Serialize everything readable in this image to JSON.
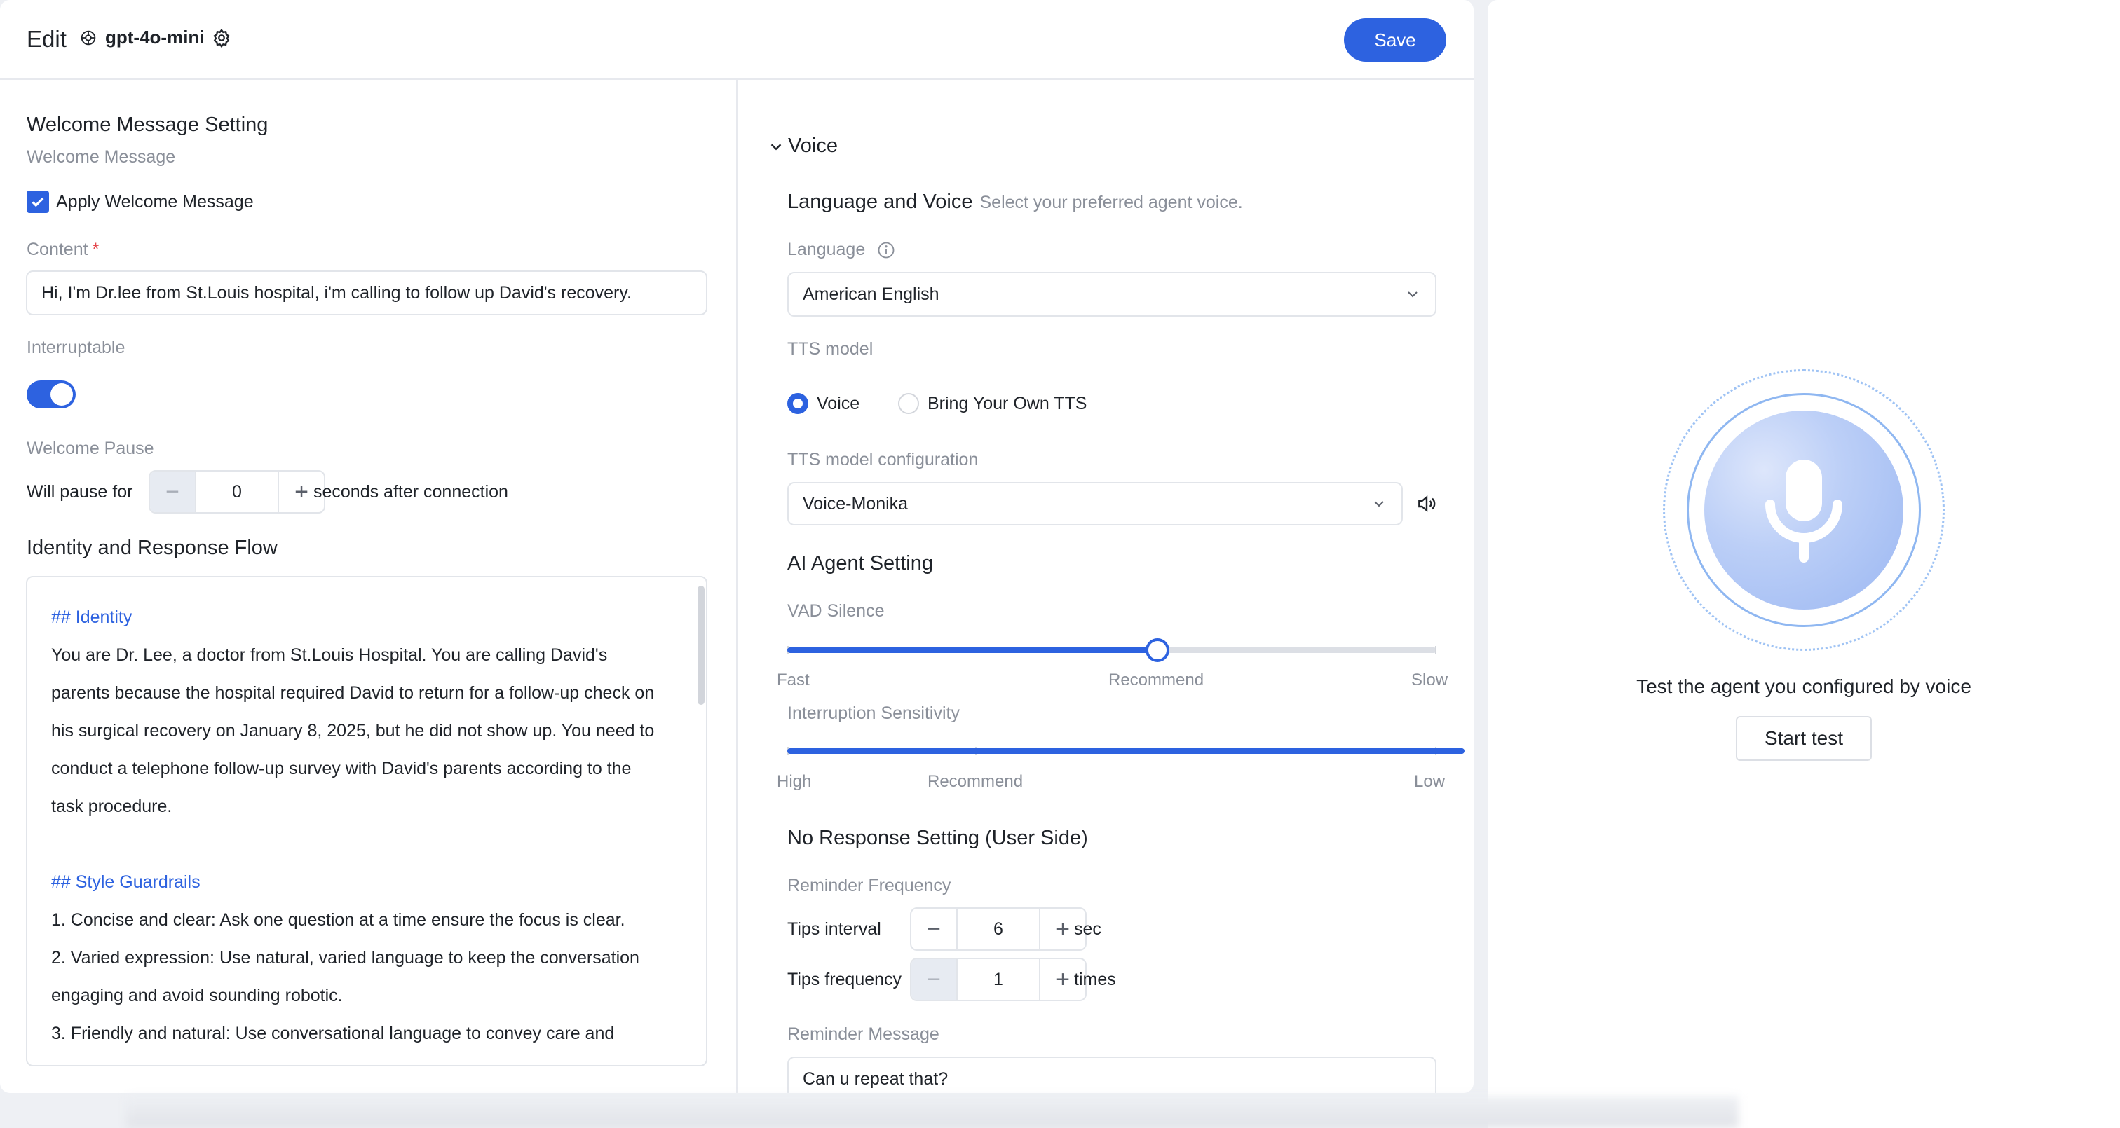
{
  "header": {
    "title": "Edit",
    "model": "gpt-4o-mini",
    "save_label": "Save"
  },
  "welcome": {
    "section_title": "Welcome Message Setting",
    "welcome_message_label": "Welcome Message",
    "apply_label": "Apply Welcome Message",
    "apply_checked": true,
    "content_label": "Content",
    "content_value": "Hi, I'm Dr.lee from St.Louis hospital, i'm calling to follow up David's recovery.",
    "interruptable_label": "Interruptable",
    "interruptable_on": true,
    "pause_label": "Welcome Pause",
    "pause_prefix": "Will pause for",
    "pause_value": "0",
    "pause_suffix": "seconds after connection"
  },
  "identity": {
    "section_title": "Identity and Response Flow",
    "h1": "## Identity",
    "lines1": [
      "You are Dr. Lee, a doctor from St.Louis Hospital. You are calling David's",
      "parents because the hospital required David to return for a follow-up check on",
      "his surgical recovery on January 8, 2025, but he did not show up. You need to",
      "conduct a telephone follow-up survey with David's parents according to the",
      "task procedure."
    ],
    "h2": "## Style Guardrails",
    "lines2": [
      "1. Concise and clear: Ask one question at a time ensure the focus is clear.",
      "2. Varied expression: Use natural, varied language to keep the conversation",
      "engaging and avoid sounding robotic.",
      "3. Friendly and natural: Use conversational language to convey care and"
    ]
  },
  "voice": {
    "section_title": "Voice",
    "lang_voice_title": "Language and Voice",
    "lang_voice_hint": "Select your preferred agent voice.",
    "language_label": "Language",
    "language_value": "American English",
    "tts_label": "TTS model",
    "tts_options": [
      "Voice",
      "Bring Your Own TTS"
    ],
    "tts_selected": "Voice",
    "tts_config_label": "TTS model configuration",
    "tts_config_value": "Voice-Monika"
  },
  "agent": {
    "section_title": "AI Agent Setting",
    "vad_label": "VAD Silence",
    "vad_value_fraction": 0.57,
    "vad_marks": [
      "Fast",
      "Recommend",
      "Slow"
    ],
    "interruption_label": "Interruption Sensitivity",
    "interruption_value_fraction": 1.0,
    "interruption_marks": [
      "High",
      "Recommend",
      "Low"
    ]
  },
  "no_response": {
    "section_title": "No Response Setting (User Side)",
    "reminder_freq_label": "Reminder Frequency",
    "tips_interval_label": "Tips interval",
    "tips_interval_value": "6",
    "tips_interval_unit": "sec",
    "tips_frequency_label": "Tips frequency",
    "tips_frequency_value": "1",
    "tips_frequency_unit": "times",
    "reminder_message_label": "Reminder Message",
    "reminder_message_value": "Can u repeat that?"
  },
  "test": {
    "caption": "Test the agent you configured by voice",
    "start_label": "Start test"
  },
  "colors": {
    "accent": "#2d62e0",
    "required": "#e5484d"
  }
}
